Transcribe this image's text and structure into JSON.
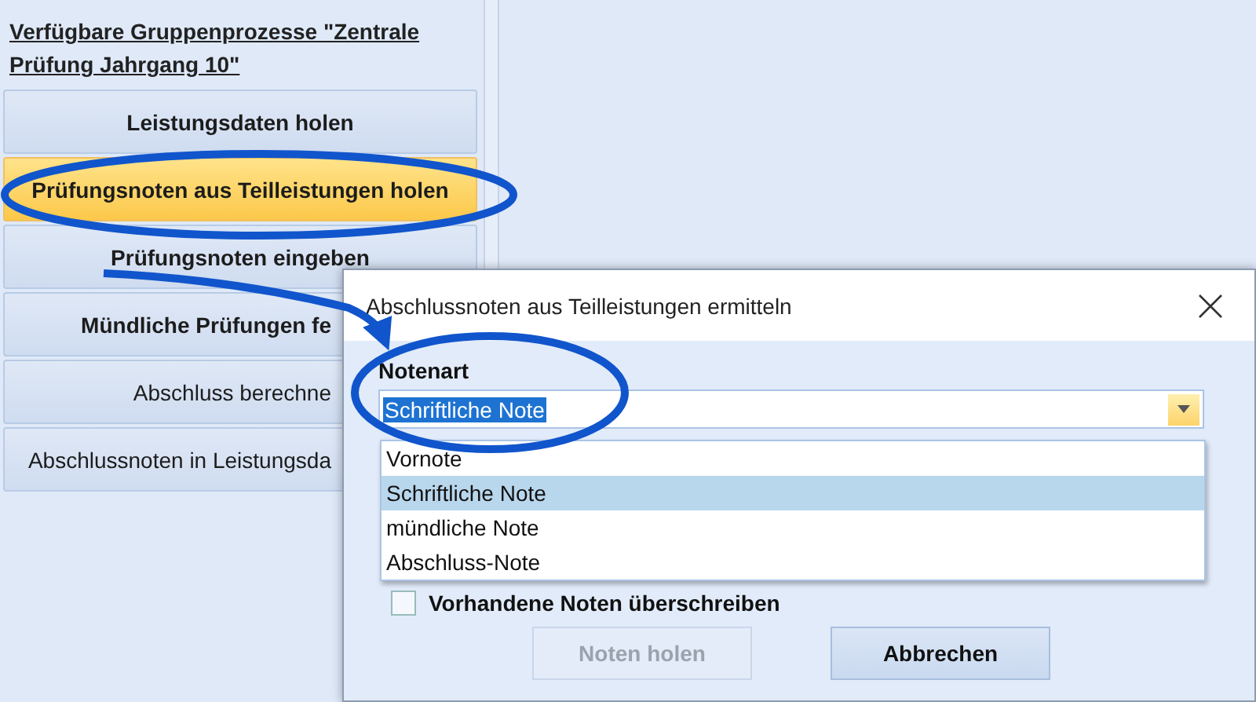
{
  "sidebar": {
    "heading": "Verfügbare Gruppenprozesse \"Zentrale Prüfung Jahrgang 10\"",
    "buttons": [
      {
        "label": "Leistungsdaten holen",
        "emphasized": true,
        "highlighted": false
      },
      {
        "label": "Prüfungsnoten aus Teilleistungen holen",
        "emphasized": true,
        "highlighted": true
      },
      {
        "label": "Prüfungsnoten eingeben",
        "emphasized": true,
        "highlighted": false
      },
      {
        "label": "Mündliche Prüfungen fe",
        "emphasized": true,
        "highlighted": false
      },
      {
        "label": "Abschluss berechne",
        "emphasized": false,
        "highlighted": false
      },
      {
        "label": "Abschlussnoten in Leistungsda",
        "emphasized": false,
        "highlighted": false
      }
    ]
  },
  "dialog": {
    "title": "Abschlussnoten aus Teilleistungen ermitteln",
    "field_label": "Notenart",
    "combo_value": "Schriftliche Note",
    "options": [
      {
        "label": "Vornote",
        "selected": false
      },
      {
        "label": "Schriftliche Note",
        "selected": true
      },
      {
        "label": "mündliche Note",
        "selected": false
      },
      {
        "label": "Abschluss-Note",
        "selected": false
      }
    ],
    "checkbox": {
      "label": "Vorhandene Noten überschreiben",
      "checked": false
    },
    "buttons": [
      {
        "label": "Noten holen",
        "disabled": true
      },
      {
        "label": "Abbrechen",
        "disabled": false
      }
    ]
  }
}
